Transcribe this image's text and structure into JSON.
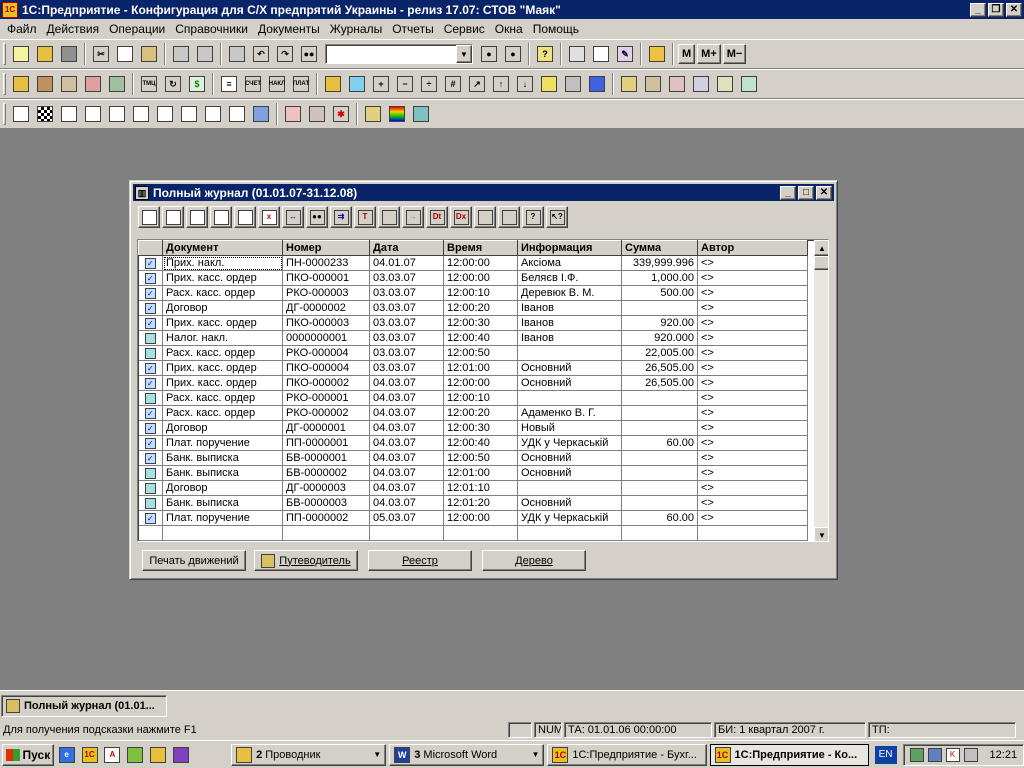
{
  "app": {
    "title": "1С:Предприятие - Конфигурация для С/Х предпрятий Украины - релиз 17.07: СТОВ \"Маяк\"",
    "icon_text": "1C"
  },
  "menu": [
    "Файл",
    "Действия",
    "Операции",
    "Справочники",
    "Документы",
    "Журналы",
    "Отчеты",
    "Сервис",
    "Окна",
    "Помощь"
  ],
  "toolbar_text": {
    "m": "M",
    "m_plus": "M+",
    "m_minus": "M−"
  },
  "journal": {
    "title": "Полный журнал (01.01.07-31.12.08)",
    "columns": [
      "Документ",
      "Номер",
      "Дата",
      "Время",
      "Информация",
      "Сумма",
      "Автор"
    ],
    "rows": [
      {
        "icon": "checked",
        "doc": "Прих. накл.",
        "num": "ПН-0000233",
        "date": "04.01.07",
        "time": "12:00:00",
        "info": "Аксіома",
        "sum": "339,999.996",
        "author": "<>"
      },
      {
        "icon": "checked",
        "doc": "Прих. касс. ордер",
        "num": "ПКО-000001",
        "date": "03.03.07",
        "time": "12:00:00",
        "info": "Беляєв І.Ф.",
        "sum": "1,000.00",
        "author": "<>"
      },
      {
        "icon": "checked",
        "doc": "Расх. касс. ордер",
        "num": "РКО-000003",
        "date": "03.03.07",
        "time": "12:00:10",
        "info": "Деревюк В. М.",
        "sum": "500.00",
        "author": "<>"
      },
      {
        "icon": "checked",
        "doc": "Договор",
        "num": "ДГ-0000002",
        "date": "03.03.07",
        "time": "12:00:20",
        "info": "Іванов",
        "sum": "",
        "author": "<>"
      },
      {
        "icon": "checked",
        "doc": "Прих. касс. ордер",
        "num": "ПКО-000003",
        "date": "03.03.07",
        "time": "12:00:30",
        "info": "Іванов",
        "sum": "920.00",
        "author": "<>"
      },
      {
        "icon": "plain",
        "doc": "Налог. накл.",
        "num": "0000000001",
        "date": "03.03.07",
        "time": "12:00:40",
        "info": "Іванов",
        "sum": "920.000",
        "author": "<>"
      },
      {
        "icon": "plain",
        "doc": "Расх. касс. ордер",
        "num": "РКО-000004",
        "date": "03.03.07",
        "time": "12:00:50",
        "info": "",
        "sum": "22,005.00",
        "author": "<>"
      },
      {
        "icon": "checked",
        "doc": "Прих. касс. ордер",
        "num": "ПКО-000004",
        "date": "03.03.07",
        "time": "12:01:00",
        "info": "Основний",
        "sum": "26,505.00",
        "author": "<>"
      },
      {
        "icon": "checked",
        "doc": "Прих. касс. ордер",
        "num": "ПКО-000002",
        "date": "04.03.07",
        "time": "12:00:00",
        "info": "Основний",
        "sum": "26,505.00",
        "author": "<>"
      },
      {
        "icon": "plain",
        "doc": "Расх. касс. ордер",
        "num": "РКО-000001",
        "date": "04.03.07",
        "time": "12:00:10",
        "info": "",
        "sum": "",
        "author": "<>"
      },
      {
        "icon": "checked",
        "doc": "Расх. касс. ордер",
        "num": "РКО-000002",
        "date": "04.03.07",
        "time": "12:00:20",
        "info": "Адаменко В. Г.",
        "sum": "",
        "author": "<>"
      },
      {
        "icon": "checked",
        "doc": "Договор",
        "num": "ДГ-0000001",
        "date": "04.03.07",
        "time": "12:00:30",
        "info": "Новый",
        "sum": "",
        "author": "<>"
      },
      {
        "icon": "checked",
        "doc": "Плат. поручение",
        "num": "ПП-0000001",
        "date": "04.03.07",
        "time": "12:00:40",
        "info": "УДК у Черкаській",
        "sum": "60.00",
        "author": "<>"
      },
      {
        "icon": "checked",
        "doc": "Банк. выписка",
        "num": "БВ-0000001",
        "date": "04.03.07",
        "time": "12:00:50",
        "info": "Основний",
        "sum": "",
        "author": "<>"
      },
      {
        "icon": "plain",
        "doc": "Банк. выписка",
        "num": "БВ-0000002",
        "date": "04.03.07",
        "time": "12:01:00",
        "info": "Основний",
        "sum": "",
        "author": "<>"
      },
      {
        "icon": "plain",
        "doc": "Договор",
        "num": "ДГ-0000003",
        "date": "04.03.07",
        "time": "12:01:10",
        "info": "",
        "sum": "",
        "author": "<>"
      },
      {
        "icon": "plain",
        "doc": "Банк. выписка",
        "num": "БВ-0000003",
        "date": "04.03.07",
        "time": "12:01:20",
        "info": "Основний",
        "sum": "",
        "author": "<>"
      },
      {
        "icon": "checked",
        "doc": "Плат. поручение",
        "num": "ПП-0000002",
        "date": "05.03.07",
        "time": "12:00:00",
        "info": "УДК у Черкаській",
        "sum": "60.00",
        "author": "<>"
      }
    ],
    "buttons": {
      "print": "Печать движений",
      "guide": "Путеводитель",
      "registry": "Реестр",
      "tree": "Дерево"
    }
  },
  "mdi_window_button": "Полный журнал (01.01...",
  "status": {
    "hint": "Для получения подсказки нажмите F1",
    "num": "NUM",
    "ta": "ТА: 01.01.06  00:00:00",
    "bi": "БИ: 1 квартал 2007 г.",
    "tp": "ТП:"
  },
  "taskbar": {
    "start": "Пуск",
    "tasks": [
      {
        "num": "2",
        "label": "Проводник",
        "icon": "folder-icon",
        "dropdown": true
      },
      {
        "num": "3",
        "label": "Microsoft Word",
        "icon": "word-icon",
        "dropdown": true
      },
      {
        "num": "",
        "label": "1С:Предприятие - Бухг...",
        "icon": "onec-icon",
        "dropdown": false
      },
      {
        "num": "",
        "label": "1С:Предприятие - Ко...",
        "icon": "onec-icon",
        "dropdown": false,
        "active": true
      }
    ],
    "lang": "EN",
    "clock": "12:21"
  },
  "colors": {
    "titlebar": "#0a246a",
    "face": "#d4d0c8",
    "desktop": "#808080"
  }
}
